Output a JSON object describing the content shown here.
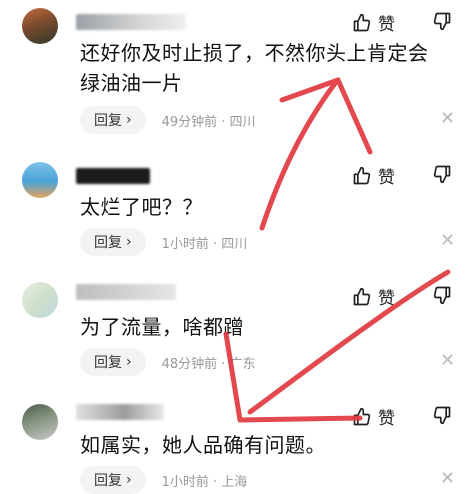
{
  "comments": [
    {
      "text": "还好你及时止损了，不然你头上肯定会绿油油一片",
      "reply_label": "回复",
      "meta": "49分钟前 · 四川",
      "like_label": "赞"
    },
    {
      "text": "太烂了吧？？",
      "reply_label": "回复",
      "meta": "1小时前 · 四川",
      "like_label": "赞"
    },
    {
      "text": "为了流量，啥都蹭",
      "reply_label": "回复",
      "meta": "48分钟前 · 广东",
      "like_label": "赞"
    },
    {
      "text": "如属实，她人品确有问题。",
      "reply_label": "回复",
      "meta": "1小时前 · 上海",
      "like_label": "赞"
    }
  ],
  "icons": {
    "like": "thumbs-up-icon",
    "dislike": "thumbs-down-icon",
    "chevron": "chevron-right-icon",
    "close": "close-icon"
  },
  "colors": {
    "annotation_arrow": "#e0393e",
    "meta_text": "#999999",
    "reply_bg": "#f3f3f3"
  }
}
